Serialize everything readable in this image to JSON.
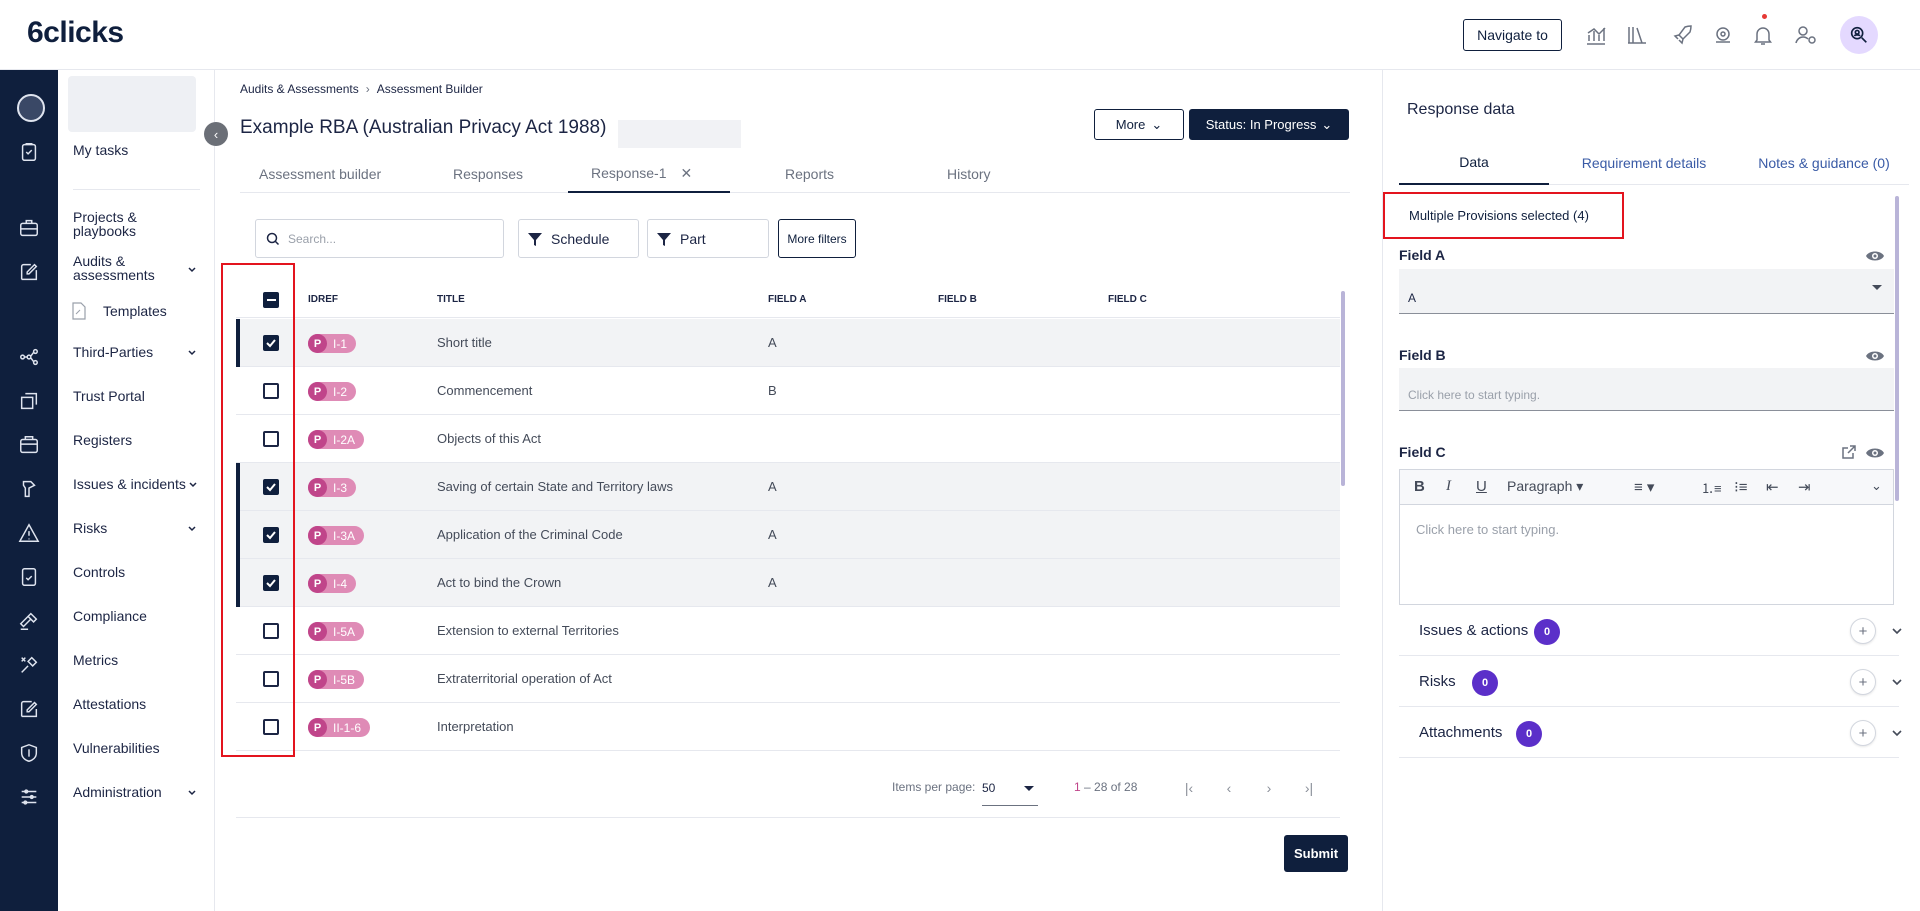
{
  "app": {
    "logo": "6clicks",
    "navigate_label": "Navigate to"
  },
  "sidebar": {
    "items": [
      {
        "label": "My tasks"
      },
      {
        "label": "Projects & playbooks"
      },
      {
        "label": "Audits & assessments"
      },
      {
        "label": "Templates"
      },
      {
        "label": "Third-Parties"
      },
      {
        "label": "Trust Portal"
      },
      {
        "label": "Registers"
      },
      {
        "label": "Issues & incidents"
      },
      {
        "label": "Risks"
      },
      {
        "label": "Controls"
      },
      {
        "label": "Compliance"
      },
      {
        "label": "Metrics"
      },
      {
        "label": "Attestations"
      },
      {
        "label": "Vulnerabilities"
      },
      {
        "label": "Administration"
      }
    ]
  },
  "breadcrumb": {
    "parent": "Audits & Assessments",
    "current": "Assessment Builder"
  },
  "page": {
    "title": "Example RBA (Australian Privacy Act 1988)",
    "more_label": "More",
    "status_label": "Status: In Progress"
  },
  "tabs": [
    "Assessment builder",
    "Responses",
    "Response-1",
    "Reports",
    "History"
  ],
  "filters": {
    "search_placeholder": "Search...",
    "schedule": "Schedule",
    "part": "Part",
    "more": "More filters"
  },
  "table": {
    "headers": [
      "IDREF",
      "TITLE",
      "FIELD A",
      "FIELD B",
      "FIELD C"
    ],
    "rows": [
      {
        "id": "I-1",
        "title": "Short title",
        "field_a": "A",
        "selected": true
      },
      {
        "id": "I-2",
        "title": "Commencement",
        "field_a": "B",
        "selected": false
      },
      {
        "id": "I-2A",
        "title": "Objects of this Act",
        "field_a": "",
        "selected": false
      },
      {
        "id": "I-3",
        "title": "Saving of certain State and Territory laws",
        "field_a": "A",
        "selected": true
      },
      {
        "id": "I-3A",
        "title": "Application of the Criminal Code",
        "field_a": "A",
        "selected": true
      },
      {
        "id": "I-4",
        "title": "Act to bind the Crown",
        "field_a": "A",
        "selected": true
      },
      {
        "id": "I-5A",
        "title": "Extension to external Territories",
        "field_a": "",
        "selected": false
      },
      {
        "id": "I-5B",
        "title": "Extraterritorial operation of Act",
        "field_a": "",
        "selected": false
      },
      {
        "id": "II-1-6",
        "title": "Interpretation",
        "field_a": "",
        "selected": false
      }
    ],
    "pill_letter": "P"
  },
  "pager": {
    "items_per_page_label": "Items per page:",
    "per_page": "50",
    "range_start": "1",
    "range_rest": " – 28 of 28"
  },
  "submit_label": "Submit",
  "response_panel": {
    "title": "Response data",
    "tabs": [
      "Data",
      "Requirement details",
      "Notes & guidance (0)"
    ],
    "multi_selected": "Multiple Provisions selected (4)",
    "field_a": {
      "label": "Field A",
      "value": "A"
    },
    "field_b": {
      "label": "Field B",
      "placeholder": "Click here to start typing."
    },
    "field_c": {
      "label": "Field C",
      "placeholder": "Click here to start typing.",
      "paragraph": "Paragraph"
    },
    "accordions": [
      {
        "label": "Issues & actions",
        "count": "0"
      },
      {
        "label": "Risks",
        "count": "0"
      },
      {
        "label": "Attachments",
        "count": "0"
      }
    ]
  },
  "colors": {
    "navy": "#0f1f3d",
    "pill": "#df8bb6",
    "badge": "#5b2fc9",
    "highlight": "#e3141e"
  }
}
